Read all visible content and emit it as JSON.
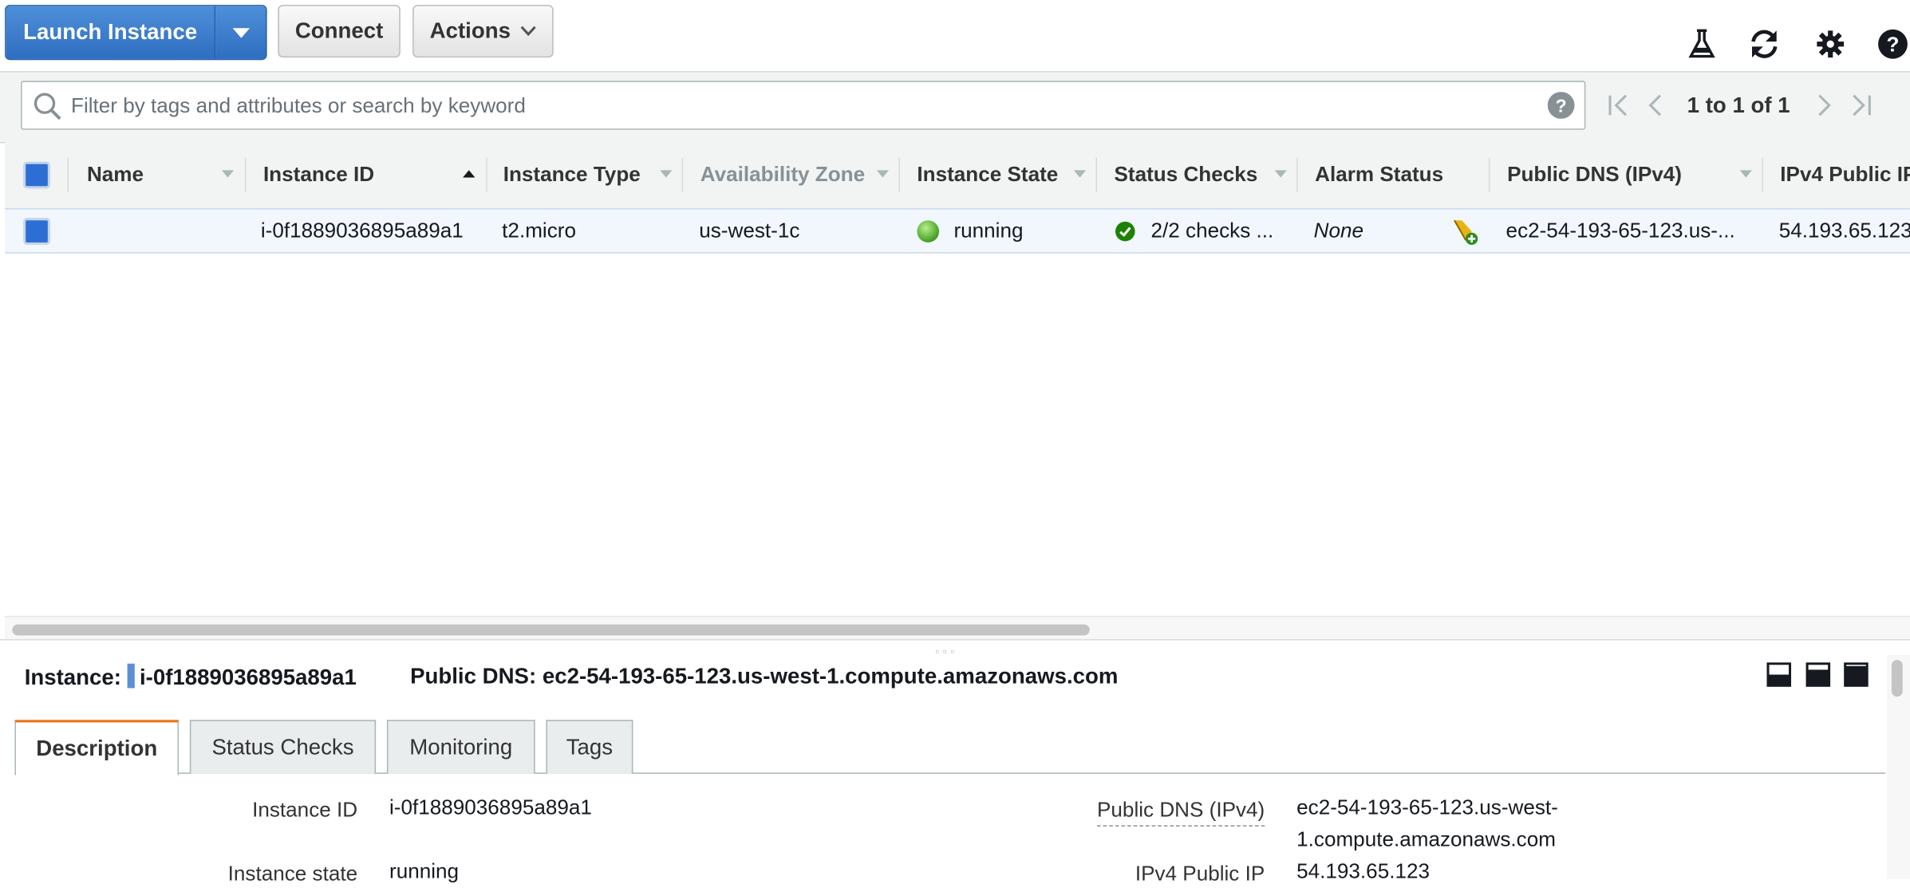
{
  "toolbar": {
    "launch_label": "Launch Instance",
    "connect_label": "Connect",
    "actions_label": "Actions"
  },
  "search": {
    "placeholder": "Filter by tags and attributes or search by keyword"
  },
  "pagination": {
    "text": "1 to 1 of 1"
  },
  "table": {
    "columns": [
      {
        "label": "Name"
      },
      {
        "label": "Instance ID",
        "sorted": "ascending"
      },
      {
        "label": "Instance Type"
      },
      {
        "label": "Availability Zone"
      },
      {
        "label": "Instance State"
      },
      {
        "label": "Status Checks"
      },
      {
        "label": "Alarm Status"
      },
      {
        "label": "Public DNS (IPv4)"
      },
      {
        "label": "IPv4 Public IP"
      }
    ],
    "rows": [
      {
        "name": "",
        "instance_id": "i-0f1889036895a89a1",
        "instance_type": "t2.micro",
        "availability_zone": "us-west-1c",
        "instance_state": "running",
        "status_checks": "2/2 checks ...",
        "alarm_status": "None",
        "public_dns": "ec2-54-193-65-123.us-...",
        "public_ip": "54.193.65.123"
      }
    ]
  },
  "detail": {
    "instance_label": "Instance:",
    "instance_id": "i-0f1889036895a89a1",
    "dns_label": "Public DNS:",
    "dns_value": "ec2-54-193-65-123.us-west-1.compute.amazonaws.com",
    "tabs": [
      "Description",
      "Status Checks",
      "Monitoring",
      "Tags"
    ],
    "active_tab": "Description",
    "fields": {
      "instance_id_label": "Instance ID",
      "instance_id_value": "i-0f1889036895a89a1",
      "instance_state_label": "Instance state",
      "instance_state_value": "running",
      "public_dns_label": "Public DNS (IPv4)",
      "public_dns_line1": "ec2-54-193-65-123.us-west-",
      "public_dns_line2": "1.compute.amazonaws.com",
      "public_ip_label": "IPv4 Public IP",
      "public_ip_value": "54.193.65.123"
    }
  },
  "colors": {
    "primary_button": "#2f6ec0",
    "running": "#54b130",
    "check_ok": "#1d8102",
    "tab_accent": "#ec7211",
    "row_selected": "#f1f7fd"
  },
  "icons": [
    "caret-down-icon",
    "flask-icon",
    "refresh-icon",
    "gear-icon",
    "help-icon",
    "search-icon",
    "first-page-icon",
    "prev-page-icon",
    "next-page-icon",
    "last-page-icon",
    "alarm-add-icon",
    "panel-bottom-icon",
    "panel-middle-icon",
    "panel-full-icon"
  ]
}
